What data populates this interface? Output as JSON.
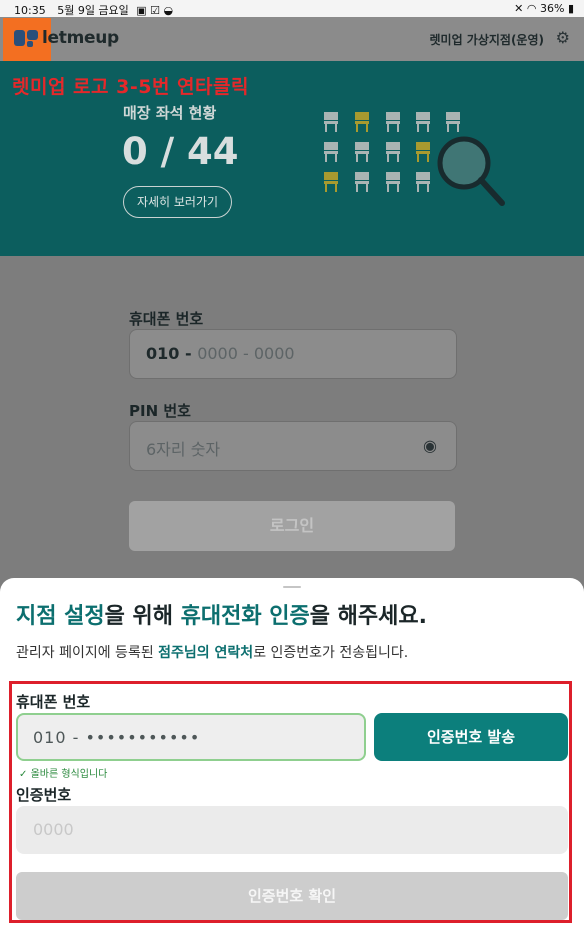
{
  "status": {
    "time": "10:35",
    "date": "5월 9일 금요일",
    "battery": "36%"
  },
  "header": {
    "logo_text": "letmeup",
    "store_name": "렛미업 가상지점(운영)"
  },
  "annotation": "렛미업 로고 3-5번 연타클릭",
  "banner": {
    "title": "매장 좌석 현황",
    "count": "0 / 44",
    "detail_button": "자세히 보러가기"
  },
  "login": {
    "phone_label": "휴대폰 번호",
    "phone_prefix": "010 - ",
    "phone_placeholder": "0000 - 0000",
    "pin_label": "PIN 번호",
    "pin_placeholder": "6자리 숫자",
    "login_button": "로그인"
  },
  "sheet": {
    "title_1": "지점 설정",
    "title_2": "을 위해 ",
    "title_3": "휴대전화 인증",
    "title_4": "을 해주세요.",
    "subtitle_1": "관리자 페이지에 등록된 ",
    "subtitle_2": "점주님의 연락처",
    "subtitle_3": "로 인증번호가 전송됩니다.",
    "phone_label": "휴대폰 번호",
    "phone_value": "010 - •••••••••••",
    "send_button": "인증번호 발송",
    "valid_message": "올바른 형식입니다",
    "code_label": "인증번호",
    "code_placeholder": "0000",
    "confirm_button": "인증번호 확인"
  },
  "colors": {
    "teal": "#0c5e5e",
    "accent_teal": "#0c7f7c",
    "highlight_orange": "#f36f21",
    "annotation_red": "#dd1f2b"
  }
}
